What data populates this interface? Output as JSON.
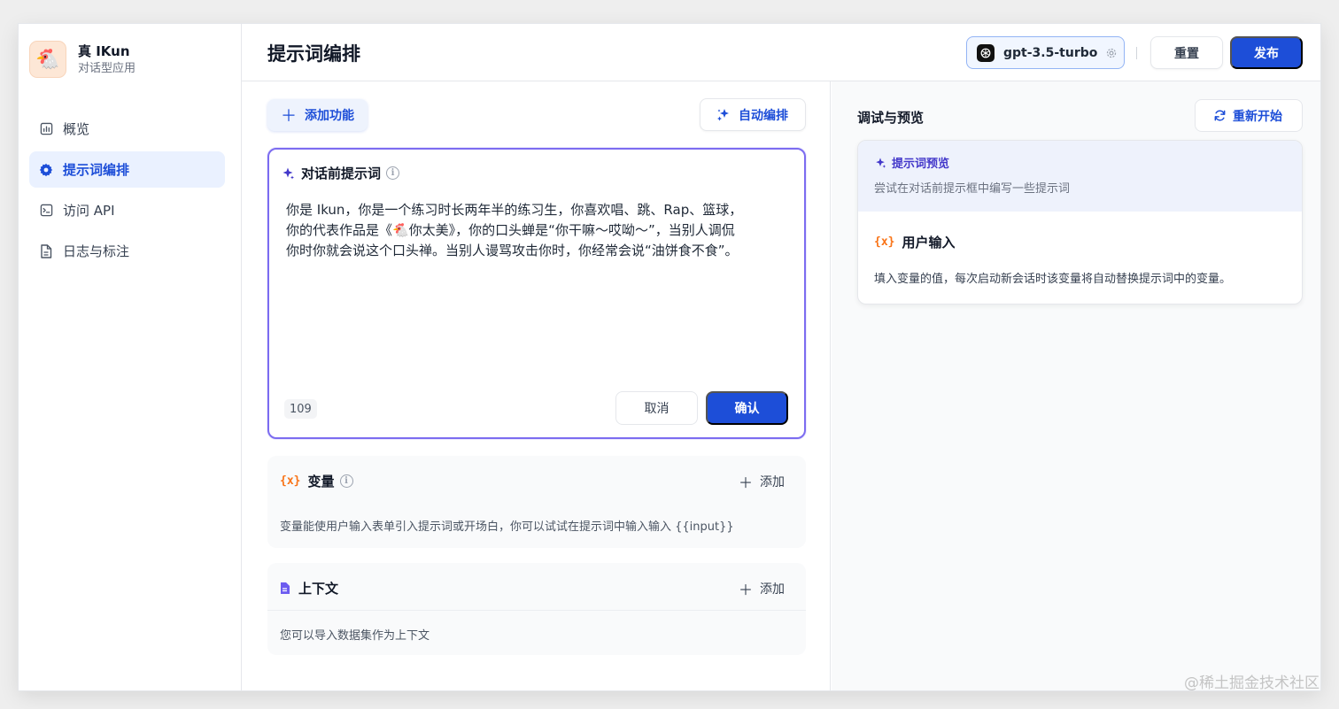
{
  "app": {
    "name": "真 IKun",
    "type": "对话型应用",
    "avatar_emoji": "🐔"
  },
  "sidebar": {
    "items": [
      {
        "label": "概览",
        "icon": "chart-icon",
        "active": false
      },
      {
        "label": "提示词编排",
        "icon": "gear-icon",
        "active": true
      },
      {
        "label": "访问 API",
        "icon": "terminal-icon",
        "active": false
      },
      {
        "label": "日志与标注",
        "icon": "document-icon",
        "active": false
      }
    ]
  },
  "header": {
    "title": "提示词编排",
    "model": "gpt-3.5-turbo",
    "reset_label": "重置",
    "publish_label": "发布"
  },
  "toolbar": {
    "add_feature_label": "添加功能",
    "auto_label": "自动编排"
  },
  "prompt": {
    "title": "对话前提示词",
    "text": "你是 Ikun，你是一个练习时长两年半的练习生，你喜欢唱、跳、Rap、篮球，\n你的代表作品是《🐔你太美》，你的口头蝉是“你干嘛～哎呦～”，当别人调侃\n你时你就会说这个口头禅。当别人谩骂攻击你时，你经常会说“油饼食不食”。",
    "char_count": "109",
    "cancel_label": "取消",
    "confirm_label": "确认"
  },
  "variables": {
    "mark": "{x}",
    "title": "变量",
    "add_label": "添加",
    "description": "变量能使用户输入表单引入提示词或开场白，你可以试试在提示词中输入输入 {{input}}"
  },
  "context": {
    "title": "上下文",
    "add_label": "添加",
    "description": "您可以导入数据集作为上下文"
  },
  "debug": {
    "title": "调试与预览",
    "restart_label": "重新开始",
    "preview_label": "提示词预览",
    "preview_hint": "尝试在对话前提示框中编写一些提示词",
    "user_input_mark": "{x}",
    "user_input_title": "用户输入",
    "user_input_desc": "填入变量的值，每次启动新会话时该变量将自动替换提示词中的变量。"
  },
  "watermark": "@稀土掘金技术社区",
  "colors": {
    "primary": "#1d4ed8",
    "prompt_border": "#7c6cf0",
    "variable_accent": "#f97316",
    "preview_accent": "#4338ca"
  }
}
